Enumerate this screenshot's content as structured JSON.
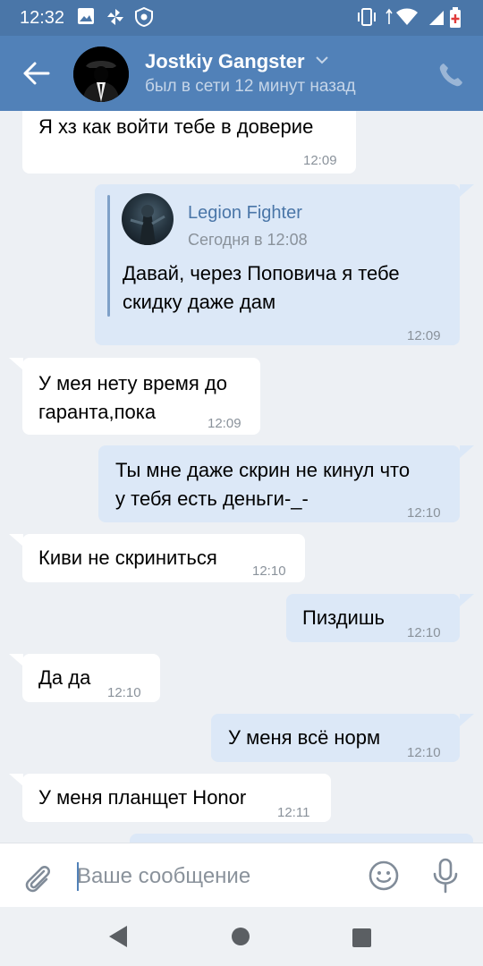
{
  "status_bar": {
    "time": "12:32",
    "icons": [
      "image-icon",
      "pinwheel-icon",
      "shield-icon",
      "vibrate-icon",
      "signal-icon",
      "wifi-icon",
      "cell-signal-icon",
      "battery-icon"
    ]
  },
  "header": {
    "name": "Jostkiy Gangster",
    "status": "был в сети 12 минут назад"
  },
  "forwarded": {
    "author": "Legion Fighter",
    "date": "Сегодня в 12:08",
    "text": "Давай, через Поповича я тебе\nскидку даже дам"
  },
  "messages": [
    {
      "dir": "in",
      "text": "Я хз как войти тебе в доверие",
      "time": "12:09"
    },
    {
      "dir": "out",
      "text": "",
      "time": "12:09"
    },
    {
      "dir": "in",
      "text": "У мея нету время до\nгаранта,пока",
      "time": "12:09"
    },
    {
      "dir": "out",
      "text": "Ты мне даже скрин не кинул что\nу тебя есть деньги-_-",
      "time": "12:10"
    },
    {
      "dir": "in",
      "text": "Киви не скриниться",
      "time": "12:10"
    },
    {
      "dir": "out",
      "text": "Пиздишь",
      "time": "12:10"
    },
    {
      "dir": "in",
      "text": "Да да",
      "time": "12:10"
    },
    {
      "dir": "out",
      "text": "У меня всё норм",
      "time": "12:10"
    },
    {
      "dir": "in",
      "text": "У меня планщет Honor",
      "time": "12:11"
    }
  ],
  "input": {
    "placeholder": "Ваше сообщение"
  },
  "colors": {
    "header": "#5181b8",
    "status_bar": "#4a76a8",
    "chat_bg": "#edf0f4",
    "incoming": "#ffffff",
    "outgoing": "#dce8f7"
  }
}
